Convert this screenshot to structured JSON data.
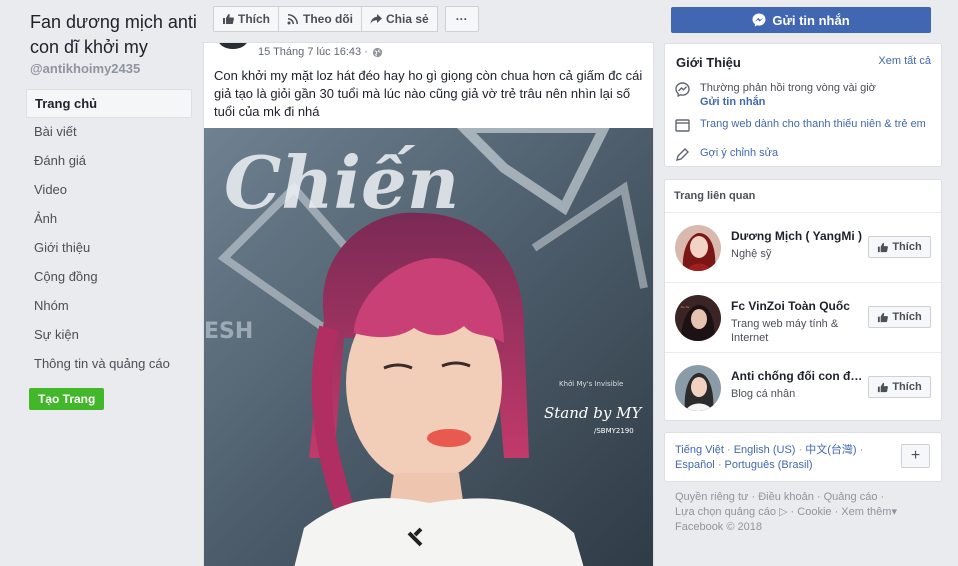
{
  "page": {
    "name": "Fan dương mịch anti con dĩ khởi my",
    "handle": "@antikhoimy2435"
  },
  "nav": [
    "Trang chủ",
    "Bài viết",
    "Đánh giá",
    "Video",
    "Ảnh",
    "Giới thiệu",
    "Cộng đồng",
    "Nhóm",
    "Sự kiện",
    "Thông tin và quảng cáo"
  ],
  "create_page": "Tạo Trang",
  "actions": {
    "like": "Thích",
    "follow": "Theo dõi",
    "share": "Chia sẻ",
    "more": "···"
  },
  "send_message": "Gửi tin nhắn",
  "post": {
    "time": "15 Tháng 7 lúc 16:43 · ",
    "text": "Con khởi my mặt loz hát đéo hay ho gì giọng còn chua hơn cả giấm đc cái giả tạo là giỏi gần 30 tuổi mà lúc nào cũng giả vờ trẻ trâu nên nhìn lại số tuổi của mk đi nhá",
    "image_text": {
      "sign": "Chiến",
      "watermark_small": "Khởi My's Invisible",
      "watermark": "Stand by MY",
      "watermark_handle": "/SBMY2190",
      "side_letters": "ESH"
    }
  },
  "about": {
    "title": "Giới Thiệu",
    "see_all": "Xem tất cả",
    "response": "Thường phản hồi trong vòng vài giờ",
    "send_message": "Gửi tin nhắn",
    "website_type": "Trang web dành cho thanh thiếu niên & trẻ em",
    "suggest_edit": "Gợi ý chỉnh sửa"
  },
  "related": {
    "title": "Trang liên quan",
    "like_label": "Thích",
    "items": [
      {
        "name": "Dương Mịch ( YangMi )",
        "sub": "Nghệ sỹ",
        "avatar_color": "#b03a3a"
      },
      {
        "name": "Fc VinZoi Toàn Quốc",
        "sub": "Trang web máy tính & Internet",
        "avatar_color": "#5a3430"
      },
      {
        "name": "Anti chống đối con điên",
        "sub": "Blog cá nhân",
        "avatar_color": "#6d7f8c"
      }
    ]
  },
  "languages": {
    "items": [
      "Tiếng Việt",
      "English (US)",
      "中文(台灣)",
      "Español",
      "Português (Brasil)"
    ],
    "plus": "+"
  },
  "footer": {
    "links": [
      "Quyền riêng tư",
      "Điều khoản",
      "Quảng cáo",
      "Lựa chọn quảng cáo",
      "Cookie",
      "Xem thêm"
    ],
    "copyright": "Facebook © 2018"
  }
}
